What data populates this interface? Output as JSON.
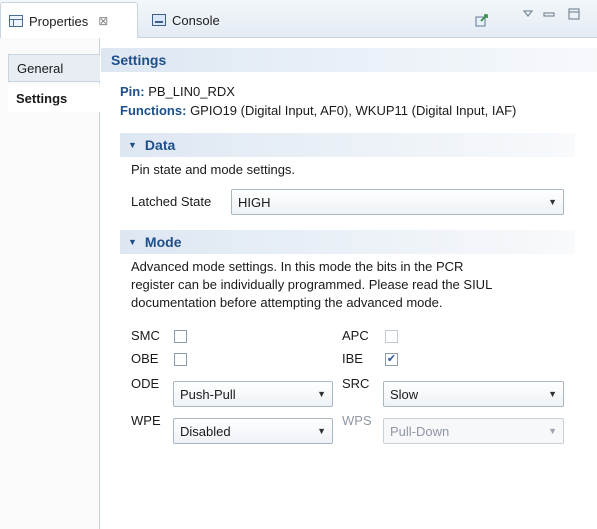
{
  "tabs": [
    {
      "label": "Properties",
      "icon": "properties-icon",
      "close": "⊠",
      "active": true
    },
    {
      "label": "Console",
      "icon": "console-icon",
      "active": false
    }
  ],
  "toolbar": {
    "pin_icon": "pin-to-view-icon",
    "menu_icon": "view-menu-icon",
    "minimize_icon": "minimize-icon",
    "maximize_icon": "maximize-icon"
  },
  "side_tabs": [
    {
      "label": "General"
    },
    {
      "label": "Settings"
    }
  ],
  "settings": {
    "header": "Settings",
    "pin_key": "Pin:",
    "pin_value": "PB_LIN0_RDX",
    "functions_key": "Functions:",
    "functions_value": "GPIO19 (Digital Input, AF0), WKUP11 (Digital Input, IAF)"
  },
  "data_section": {
    "title": "Data",
    "description": "Pin state and mode settings.",
    "latched_label": "Latched State",
    "latched_value": "HIGH"
  },
  "mode_section": {
    "title": "Mode",
    "description_lines": [
      "Advanced mode settings. In this mode the bits in the PCR",
      "register can be individually programmed. Please read the SIUL",
      "documentation before attempting the advanced mode."
    ],
    "smc_label": "SMC",
    "smc_checked": false,
    "apc_label": "APC",
    "apc_checked": false,
    "obe_label": "OBE",
    "obe_checked": false,
    "ibe_label": "IBE",
    "ibe_checked": true,
    "ode_label": "ODE",
    "ode_value": "Push-Pull",
    "src_label": "SRC",
    "src_value": "Slow",
    "wpe_label": "WPE",
    "wpe_value": "Disabled",
    "wps_label": "WPS",
    "wps_value": "Pull-Down"
  },
  "colors": {
    "header_text": "#1f4f8a",
    "header_bg": "#dde7f2",
    "check_mark": "#2a55a0"
  }
}
